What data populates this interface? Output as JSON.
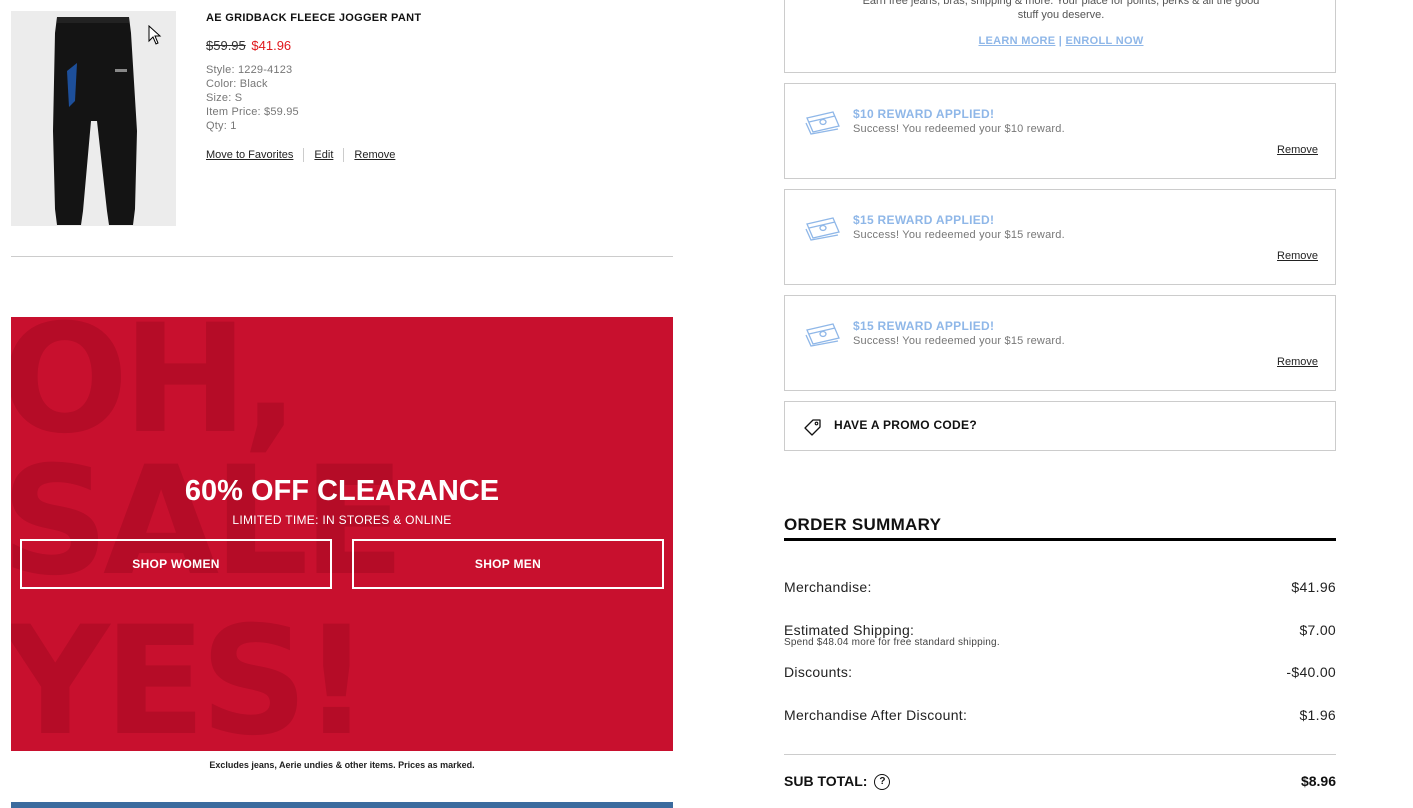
{
  "product": {
    "name": "AE GRIDBACK FLEECE JOGGER PANT",
    "price_original": "$59.95",
    "price_sale": "$41.96",
    "style": "Style: 1229-4123",
    "color": "Color: Black",
    "size": "Size: S",
    "item_price": "Item Price: $59.95",
    "qty": "Qty: 1",
    "actions": {
      "move_to_favorites": "Move to Favorites",
      "edit": "Edit",
      "remove": "Remove"
    }
  },
  "promo": {
    "background_words": [
      "OH,",
      "SALE",
      "YES!"
    ],
    "title": "60% OFF CLEARANCE",
    "subtitle": "LIMITED TIME: IN STORES & ONLINE",
    "shop_women": "SHOP WOMEN",
    "shop_men": "SHOP MEN",
    "note": "Excludes jeans, Aerie undies & other items. Prices as marked."
  },
  "rewards": {
    "description_line1": "Earn free jeans, bras, shipping & more. Your place for points, perks & all the good",
    "description_line2": "stuff you deserve.",
    "learn_more": "LEARN MORE",
    "link_separator": "|",
    "enroll_now": "ENROLL NOW",
    "applied": [
      {
        "title": "$10 REWARD APPLIED!",
        "message": "Success! You redeemed your $10 reward.",
        "remove": "Remove"
      },
      {
        "title": "$15 REWARD APPLIED!",
        "message": "Success! You redeemed your $15 reward.",
        "remove": "Remove"
      },
      {
        "title": "$15 REWARD APPLIED!",
        "message": "Success! You redeemed your $15 reward.",
        "remove": "Remove"
      }
    ]
  },
  "promo_code": {
    "label": "HAVE A PROMO CODE?"
  },
  "order_summary": {
    "title": "ORDER SUMMARY",
    "merchandise_label": "Merchandise:",
    "merchandise_value": "$41.96",
    "shipping_label": "Estimated Shipping:",
    "shipping_note": "Spend $48.04 more for free standard shipping.",
    "shipping_value": "$7.00",
    "discounts_label": "Discounts:",
    "discounts_value": "-$40.00",
    "after_discount_label": "Merchandise After Discount:",
    "after_discount_value": "$1.96",
    "subtotal_label": "SUB TOTAL:",
    "subtotal_help": "?",
    "subtotal_value": "$8.96"
  },
  "colors": {
    "sale_red": "#e0181c",
    "banner_red": "#c8102e",
    "reward_blue": "#8fb7e8"
  }
}
